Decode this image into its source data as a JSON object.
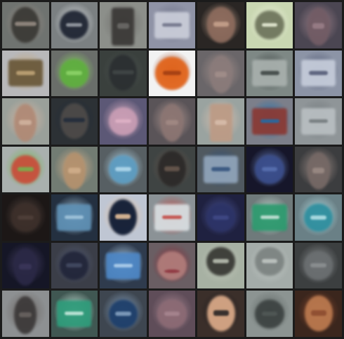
{
  "grid": {
    "rows": 7,
    "cols": 7,
    "tiles": [
      {
        "subject": "face-with-glasses",
        "bg": "#6f7370",
        "fg": "#3b3a36",
        "accent": "#9a8f86"
      },
      {
        "subject": "dark-phone",
        "bg": "#7b8082",
        "fg": "#1f2533",
        "accent": "#e2e6ea"
      },
      {
        "subject": "v-sign-hand",
        "bg": "#8c8f8a",
        "fg": "#3c3a38",
        "accent": "#6d6c69"
      },
      {
        "subject": "white-card",
        "bg": "#8f93a6",
        "fg": "#c9ccd8",
        "accent": "#6b6f85"
      },
      {
        "subject": "face-close-up",
        "bg": "#2a2624",
        "fg": "#8b6a5c",
        "accent": "#c9a48e"
      },
      {
        "subject": "bright-window",
        "bg": "#c9d7b2",
        "fg": "#6f765d",
        "accent": "#eef3dd"
      },
      {
        "subject": "hand-blur",
        "bg": "#4b4652",
        "fg": "#725c65",
        "accent": "#9b8089"
      },
      {
        "subject": "framed-picture",
        "bg": "#b8b8ba",
        "fg": "#6b5a3c",
        "accent": "#c4a87a"
      },
      {
        "subject": "green-plant",
        "bg": "#6a6e6a",
        "fg": "#5fae3f",
        "accent": "#8fd56a"
      },
      {
        "subject": "face-dark-glasses",
        "bg": "#3a403d",
        "fg": "#2b2f31",
        "accent": "#4e5553"
      },
      {
        "subject": "pumpkin",
        "bg": "#f2f2f2",
        "fg": "#e2661e",
        "accent": "#9d3b12"
      },
      {
        "subject": "hand-blur",
        "bg": "#6a6669",
        "fg": "#8a7b7a",
        "accent": "#a38f8b"
      },
      {
        "subject": "white-sign",
        "bg": "#7e8885",
        "fg": "#a8b0ad",
        "accent": "#3a4140"
      },
      {
        "subject": "card",
        "bg": "#8c94a6",
        "fg": "#c4cbd9",
        "accent": "#4f5672"
      },
      {
        "subject": "fingers",
        "bg": "#9aa09a",
        "fg": "#b08a76",
        "accent": "#d2b5a1"
      },
      {
        "subject": "face-glasses",
        "bg": "#2c3135",
        "fg": "#4d4a48",
        "accent": "#1f2a3a"
      },
      {
        "subject": "pink-object",
        "bg": "#5c5876",
        "fg": "#c79cb3",
        "accent": "#e0b3c7"
      },
      {
        "subject": "hand-dark",
        "bg": "#5a5458",
        "fg": "#8b7572",
        "accent": "#b09690"
      },
      {
        "subject": "v-sign-hand",
        "bg": "#9aa3a0",
        "fg": "#bc9b86",
        "accent": "#d9bfad"
      },
      {
        "subject": "colorful-card",
        "bg": "#7c7f8a",
        "fg": "#8a3b36",
        "accent": "#1a70b0"
      },
      {
        "subject": "grey-card",
        "bg": "#8f9598",
        "fg": "#b8bec1",
        "accent": "#6f7679"
      },
      {
        "subject": "colorful-food",
        "bg": "#a9b0ae",
        "fg": "#c84f3c",
        "accent": "#72b64e"
      },
      {
        "subject": "palm",
        "bg": "#727c73",
        "fg": "#b3916e",
        "accent": "#d2b08c"
      },
      {
        "subject": "blue-disc",
        "bg": "#575f63",
        "fg": "#5d9cc1",
        "accent": "#b7dcee"
      },
      {
        "subject": "bearded-face",
        "bg": "#3f4443",
        "fg": "#2c2a29",
        "accent": "#6b5a50"
      },
      {
        "subject": "blue-card",
        "bg": "#505960",
        "fg": "#8fa3b8",
        "accent": "#2f4f7a"
      },
      {
        "subject": "dark-blue-light",
        "bg": "#16162a",
        "fg": "#3a4d8a",
        "accent": "#6b86c7"
      },
      {
        "subject": "hands-blur",
        "bg": "#3c3d3f",
        "fg": "#756865",
        "accent": "#9c8c86"
      },
      {
        "subject": "dark-room",
        "bg": "#1c1716",
        "fg": "#3c2f2a",
        "accent": "#5b4a43"
      },
      {
        "subject": "blue-card",
        "bg": "#243040",
        "fg": "#5e8fb3",
        "accent": "#a6c8de"
      },
      {
        "subject": "cartoon-man",
        "bg": "#bfc6d3",
        "fg": "#0f1b33",
        "accent": "#f1c9a0"
      },
      {
        "subject": "white-card-red",
        "bg": "#8b9296",
        "fg": "#d7dde0",
        "accent": "#c2433d"
      },
      {
        "subject": "dark-blue-blur",
        "bg": "#1f2140",
        "fg": "#2c3366",
        "accent": "#4c5699"
      },
      {
        "subject": "green-card",
        "bg": "#6f7a7b",
        "fg": "#2e9a6f",
        "accent": "#cfe6dd"
      },
      {
        "subject": "teal-pattern",
        "bg": "#6a8086",
        "fg": "#2f8f9f",
        "accent": "#b9e3e8"
      },
      {
        "subject": "dark-hand",
        "bg": "#151626",
        "fg": "#2a2845",
        "accent": "#453f66"
      },
      {
        "subject": "dark-blob",
        "bg": "#3b3e48",
        "fg": "#22263a",
        "accent": "#57607a"
      },
      {
        "subject": "blue-screen",
        "bg": "#2f3b4d",
        "fg": "#4d86c4",
        "accent": "#b5d4ee"
      },
      {
        "subject": "open-mouth",
        "bg": "#6a5e63",
        "fg": "#b07c7a",
        "accent": "#8b2f3a"
      },
      {
        "subject": "earphones",
        "bg": "#a7b1a3",
        "fg": "#3a3b36",
        "accent": "#c0c6b8"
      },
      {
        "subject": "earphones",
        "bg": "#a4aca9",
        "fg": "#7d8482",
        "accent": "#c3c9c6"
      },
      {
        "subject": "grey-blur",
        "bg": "#3c3f40",
        "fg": "#6a6e70",
        "accent": "#8e9294"
      },
      {
        "subject": "crossed-fingers",
        "bg": "#8d9092",
        "fg": "#3d3a3a",
        "accent": "#6b6562"
      },
      {
        "subject": "teal-card",
        "bg": "#405752",
        "fg": "#2f9b7a",
        "accent": "#d1eee3"
      },
      {
        "subject": "blue-ring",
        "bg": "#3e4650",
        "fg": "#1e3f6b",
        "accent": "#8aa6c4"
      },
      {
        "subject": "pink-blur",
        "bg": "#5f4d59",
        "fg": "#8b6a74",
        "accent": "#a98792"
      },
      {
        "subject": "cartoon-face",
        "bg": "#3b2f2a",
        "fg": "#d7a786",
        "accent": "#1f1d1f"
      },
      {
        "subject": "dark-shape",
        "bg": "#8c9492",
        "fg": "#3e4443",
        "accent": "#5c6462"
      },
      {
        "subject": "portrait",
        "bg": "#3b261d",
        "fg": "#b9784e",
        "accent": "#8a4a2e"
      }
    ]
  }
}
